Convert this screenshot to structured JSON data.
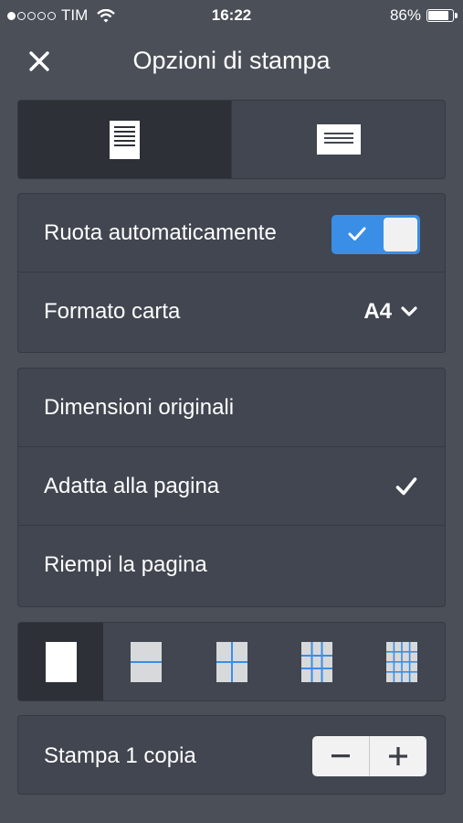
{
  "status_bar": {
    "carrier": "TIM",
    "time": "16:22",
    "battery": "86%",
    "battery_level": 0.86
  },
  "header": {
    "title": "Opzioni di stampa",
    "close_icon": "close-icon"
  },
  "orientation": {
    "selected": "portrait",
    "options": [
      "portrait-icon",
      "landscape-icon"
    ]
  },
  "settings": {
    "auto_rotate_label": "Ruota automaticamente",
    "auto_rotate_on": true,
    "paper_label": "Formato carta",
    "paper_value": "A4"
  },
  "scaling": {
    "options": [
      "Dimensioni originali",
      "Adatta alla pagina",
      "Riempi la pagina"
    ],
    "selected": "Adatta alla pagina"
  },
  "tiling": {
    "selected": "1-page",
    "options": [
      "1-page-icon",
      "2-pages-icon",
      "4-pages-icon",
      "9-pages-icon",
      "16-pages-icon"
    ]
  },
  "copies": {
    "label": "Stampa 1 copia",
    "minus_icon": "minus-icon",
    "plus_icon": "plus-icon"
  },
  "colors": {
    "background": "#4a4f58",
    "card": "#414650",
    "selected": "#2d3037",
    "accent": "#3a8ee6",
    "grid_line": "#3a8ee6"
  }
}
